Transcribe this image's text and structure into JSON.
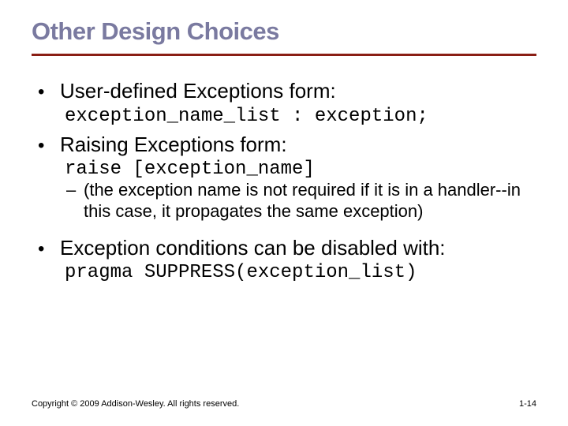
{
  "title": "Other Design Choices",
  "bullets": [
    {
      "text": "User-defined Exceptions form:",
      "code": "exception_name_list : exception;"
    },
    {
      "text": "Raising Exceptions form:",
      "code": "raise [exception_name]",
      "sub": "(the exception name is not required if it is in a handler--in this case, it propagates the same exception)"
    },
    {
      "text": "Exception conditions can be disabled with:",
      "code": "pragma SUPPRESS(exception_list)"
    }
  ],
  "footer_left": "Copyright © 2009 Addison-Wesley. All rights reserved.",
  "footer_right": "1-14"
}
